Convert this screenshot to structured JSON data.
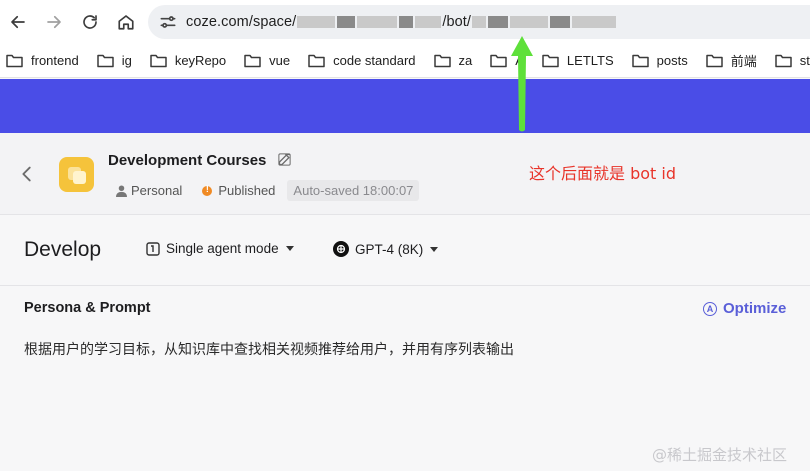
{
  "browser": {
    "url_prefix": "coze.com/space/",
    "url_middle": "/bot/",
    "bookmarks": [
      {
        "label": "frontend"
      },
      {
        "label": "ig"
      },
      {
        "label": "keyRepo"
      },
      {
        "label": "vue"
      },
      {
        "label": "code  standard"
      },
      {
        "label": "za"
      },
      {
        "label": "A"
      },
      {
        "label": "LETLTS"
      },
      {
        "label": "posts"
      },
      {
        "label": "前端"
      },
      {
        "label": "stu"
      }
    ]
  },
  "bot": {
    "name": "Development Courses",
    "owner": "Personal",
    "status": "Published",
    "autosave": "Auto-saved 18:00:07"
  },
  "annotation": "这个后面就是 bot id",
  "develop": {
    "title": "Develop",
    "mode": "Single agent mode",
    "model": "GPT-4 (8K)"
  },
  "persona": {
    "title": "Persona & Prompt",
    "optimize_label": "Optimize",
    "prompt": "根据用户的学习目标，从知识库中查找相关视频推荐给用户，并用有序列表输出"
  },
  "watermark": "@稀土掘金技术社区",
  "colors": {
    "banner": "#4a4de7",
    "annotation": "#e8342a",
    "arrow": "#5ee03a",
    "optimize": "#5a5fd8",
    "bot_avatar": "#f5c33b",
    "published_dot": "#f08a24"
  }
}
